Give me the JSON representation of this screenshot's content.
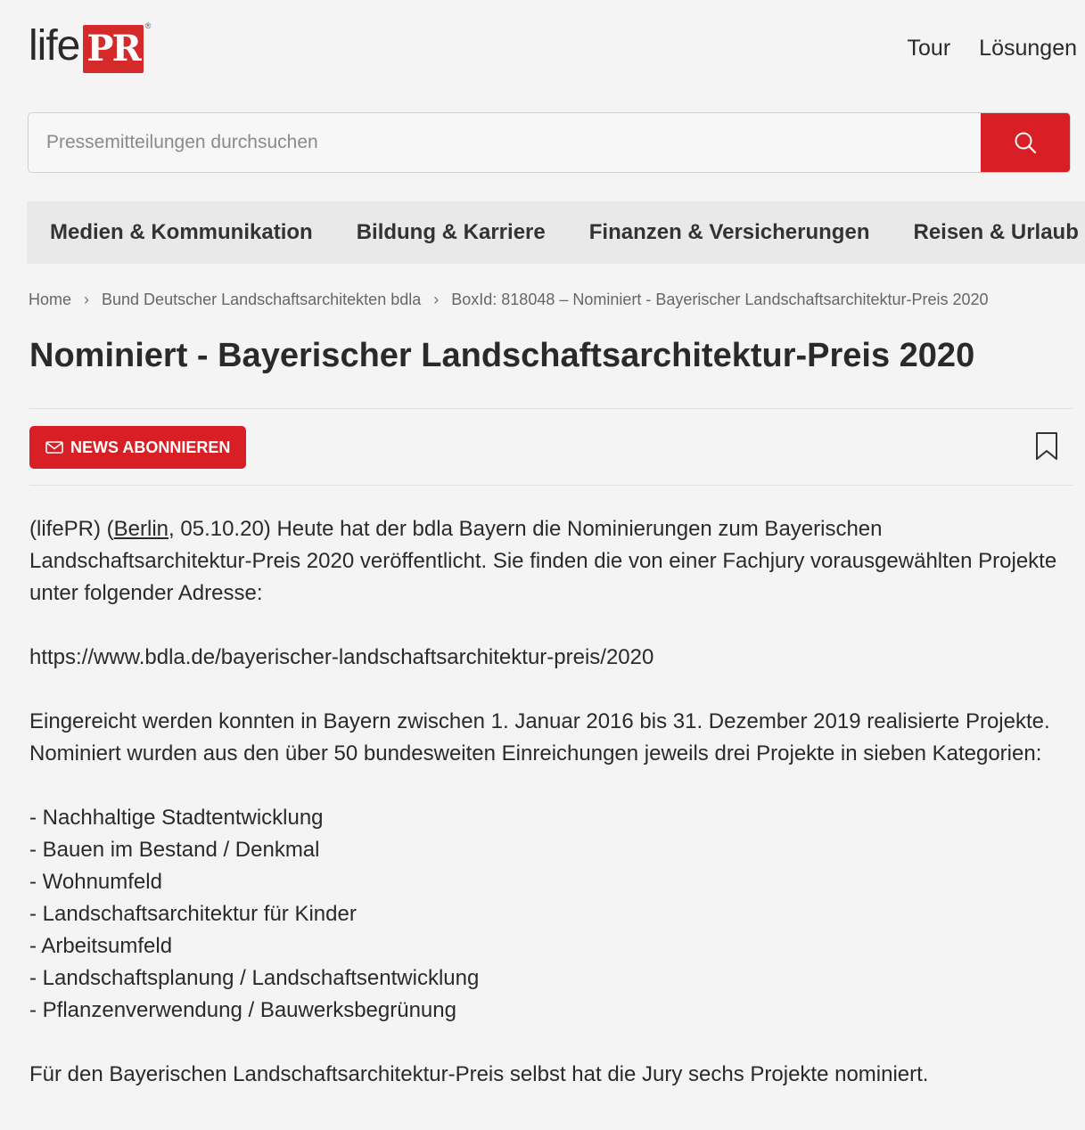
{
  "header": {
    "logo_text": "life",
    "logo_mark": "PR",
    "logo_reg": "®",
    "nav": [
      "Tour",
      "Lösungen"
    ]
  },
  "search": {
    "placeholder": "Pressemitteilungen durchsuchen",
    "value": "",
    "icon": "search-icon"
  },
  "categories": [
    "Medien & Kommunikation",
    "Bildung & Karriere",
    "Finanzen & Versicherungen",
    "Reisen & Urlaub"
  ],
  "breadcrumb": [
    "Home",
    "Bund Deutscher Landschaftsarchitekten bdla",
    "BoxId: 818048 – Nominiert - Bayerischer Landschaftsarchitektur-Preis 2020"
  ],
  "article": {
    "title": "Nominiert - Bayerischer Landschaftsarchitektur-Preis 2020",
    "subscribe_label": "NEWS ABONNIEREN",
    "intro_prefix": "(lifePR) (",
    "intro_location": "Berlin",
    "intro_rest": ", 05.10.20) Heute hat der bdla Bayern die Nominierungen zum Bayerischen Landschaftsarchitektur-Preis 2020 veröffentlicht. Sie finden die von einer Fachjury vorausgewählten Projekte unter folgender Adresse:",
    "url": "https://www.bdla.de/bayerischer-landschaftsarchitektur-preis/2020",
    "para2": "Eingereicht werden konnten in Bayern zwischen 1. Januar 2016 bis 31. Dezember 2019 realisierte Projekte. Nominiert wurden aus den über 50 bundesweiten Einreichungen jeweils drei Projekte in sieben Kategorien:",
    "list": [
      "- Nachhaltige Stadtentwicklung",
      "- Bauen im Bestand / Denkmal",
      "- Wohnumfeld",
      "- Landschaftsarchitektur für Kinder",
      "- Arbeitsumfeld",
      "- Landschaftsplanung / Landschaftsentwicklung",
      "- Pflanzenverwendung / Bauwerksbegrünung"
    ],
    "para3": "Für den Bayerischen Landschaftsarchitektur-Preis selbst hat die Jury sechs Projekte nominiert."
  },
  "colors": {
    "accent": "#d81f26",
    "text": "#2a2a2a",
    "background": "#f4f4f4",
    "category_bar": "#e9e9e9"
  }
}
